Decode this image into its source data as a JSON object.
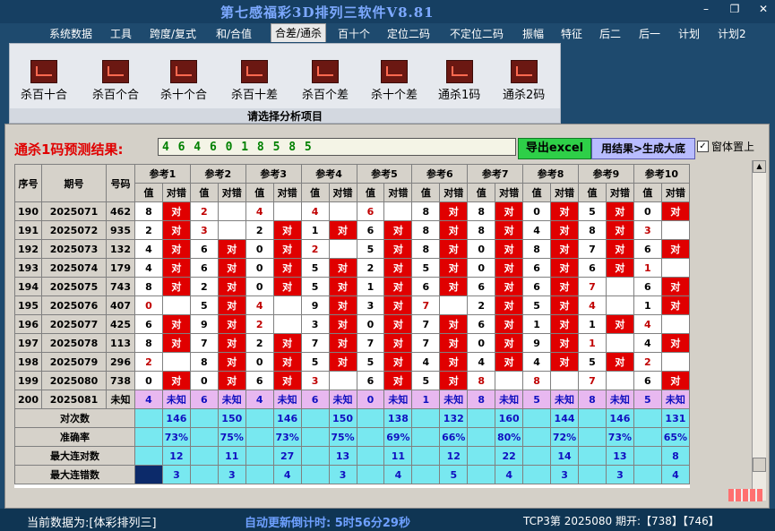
{
  "app": {
    "title": "第七感福彩3D排列三软件V8.81",
    "window_buttons": [
      "–",
      "❐",
      "✕"
    ]
  },
  "menu": [
    "系统数据",
    "工具",
    "跨度/复式",
    "和/合值",
    "合差/通杀",
    "百十个",
    "定位二码",
    "不定位二码",
    "振幅",
    "特征",
    "后二",
    "后一",
    "计划",
    "计划2"
  ],
  "menu_active": "合差/通杀",
  "ribbon": {
    "buttons": [
      "杀百十合",
      "杀百个合",
      "杀十个合",
      "杀百十差",
      "杀百个差",
      "杀十个差",
      "通杀1码",
      "通杀2码"
    ],
    "caption": "请选择分析项目"
  },
  "prediction": {
    "label": "通杀1码预测结果:",
    "value": "4 6 4 6 0 1 8 5 8 5",
    "export_button": "导出excel",
    "generate_button": "用结果>生成大底",
    "checkbox_label": "窗体置上",
    "checkbox_checked": true
  },
  "table": {
    "headers": {
      "seq": "序号",
      "period": "期号",
      "number": "号码",
      "value": "值",
      "result": "对错"
    },
    "refs": [
      "参考1",
      "参考2",
      "参考3",
      "参考4",
      "参考5",
      "参考6",
      "参考7",
      "参考8",
      "参考9",
      "参考10"
    ],
    "correct_mark": "对",
    "rows": [
      {
        "seq": "190",
        "period": "2025071",
        "number": "462",
        "vals": [
          "8",
          "2",
          "4",
          "4",
          "6",
          "8",
          "8",
          "0",
          "5",
          "0"
        ],
        "res": [
          1,
          0,
          0,
          0,
          0,
          1,
          1,
          1,
          1,
          1
        ],
        "hot": [
          0,
          1,
          1,
          1,
          1,
          0,
          0,
          0,
          0,
          0
        ]
      },
      {
        "seq": "191",
        "period": "2025072",
        "number": "935",
        "vals": [
          "2",
          "3",
          "2",
          "1",
          "6",
          "8",
          "8",
          "4",
          "8",
          "3"
        ],
        "res": [
          1,
          0,
          1,
          1,
          1,
          1,
          1,
          1,
          1,
          0
        ],
        "hot": [
          0,
          1,
          0,
          0,
          0,
          0,
          0,
          0,
          0,
          1
        ]
      },
      {
        "seq": "192",
        "period": "2025073",
        "number": "132",
        "vals": [
          "4",
          "6",
          "0",
          "2",
          "5",
          "8",
          "0",
          "8",
          "7",
          "6"
        ],
        "res": [
          1,
          1,
          1,
          0,
          1,
          1,
          1,
          1,
          1,
          1
        ],
        "hot": [
          0,
          0,
          0,
          1,
          0,
          0,
          0,
          0,
          0,
          0
        ]
      },
      {
        "seq": "193",
        "period": "2025074",
        "number": "179",
        "vals": [
          "4",
          "6",
          "0",
          "5",
          "2",
          "5",
          "0",
          "6",
          "6",
          "1"
        ],
        "res": [
          1,
          1,
          1,
          1,
          1,
          1,
          1,
          1,
          1,
          0
        ],
        "hot": [
          0,
          0,
          0,
          0,
          0,
          0,
          0,
          0,
          0,
          1
        ]
      },
      {
        "seq": "194",
        "period": "2025075",
        "number": "743",
        "vals": [
          "8",
          "2",
          "0",
          "5",
          "1",
          "6",
          "6",
          "6",
          "7",
          "6"
        ],
        "res": [
          1,
          1,
          1,
          1,
          1,
          1,
          1,
          1,
          0,
          1
        ],
        "hot": [
          0,
          0,
          0,
          0,
          0,
          0,
          0,
          0,
          1,
          0
        ]
      },
      {
        "seq": "195",
        "period": "2025076",
        "number": "407",
        "vals": [
          "0",
          "5",
          "4",
          "9",
          "3",
          "7",
          "2",
          "5",
          "4",
          "1"
        ],
        "res": [
          0,
          1,
          0,
          1,
          1,
          0,
          1,
          1,
          0,
          1
        ],
        "hot": [
          1,
          0,
          1,
          0,
          0,
          1,
          0,
          0,
          1,
          0
        ]
      },
      {
        "seq": "196",
        "period": "2025077",
        "number": "425",
        "vals": [
          "6",
          "9",
          "2",
          "3",
          "0",
          "7",
          "6",
          "1",
          "1",
          "4"
        ],
        "res": [
          1,
          1,
          0,
          1,
          1,
          1,
          1,
          1,
          1,
          0
        ],
        "hot": [
          0,
          0,
          1,
          0,
          0,
          0,
          0,
          0,
          0,
          1
        ]
      },
      {
        "seq": "197",
        "period": "2025078",
        "number": "113",
        "vals": [
          "8",
          "7",
          "2",
          "7",
          "7",
          "7",
          "0",
          "9",
          "1",
          "4"
        ],
        "res": [
          1,
          1,
          1,
          1,
          1,
          1,
          1,
          1,
          0,
          1
        ],
        "hot": [
          0,
          0,
          0,
          0,
          0,
          0,
          0,
          0,
          1,
          0
        ]
      },
      {
        "seq": "198",
        "period": "2025079",
        "number": "296",
        "vals": [
          "2",
          "8",
          "0",
          "5",
          "5",
          "4",
          "4",
          "4",
          "5",
          "2"
        ],
        "res": [
          0,
          1,
          1,
          1,
          1,
          1,
          1,
          1,
          1,
          0
        ],
        "hot": [
          1,
          0,
          0,
          0,
          0,
          0,
          0,
          0,
          0,
          1
        ]
      },
      {
        "seq": "199",
        "period": "2025080",
        "number": "738",
        "vals": [
          "0",
          "0",
          "6",
          "3",
          "6",
          "5",
          "8",
          "8",
          "7",
          "6"
        ],
        "res": [
          1,
          1,
          1,
          0,
          1,
          1,
          0,
          0,
          0,
          1
        ],
        "hot": [
          0,
          0,
          0,
          1,
          0,
          0,
          1,
          1,
          1,
          0
        ]
      }
    ],
    "unknown_row": {
      "seq": "200",
      "period": "2025081",
      "number": "未知",
      "vals": [
        "4",
        "6",
        "4",
        "6",
        "0",
        "1",
        "8",
        "5",
        "8",
        "5"
      ],
      "status": "未知"
    },
    "stats": [
      {
        "label": "对次数",
        "values": [
          "146",
          "150",
          "146",
          "150",
          "138",
          "132",
          "160",
          "144",
          "146",
          "131"
        ]
      },
      {
        "label": "准确率",
        "values": [
          "73%",
          "75%",
          "73%",
          "75%",
          "69%",
          "66%",
          "80%",
          "72%",
          "73%",
          "65%"
        ]
      },
      {
        "label": "最大连对数",
        "values": [
          "12",
          "11",
          "27",
          "13",
          "11",
          "12",
          "22",
          "14",
          "13",
          "8"
        ]
      },
      {
        "label": "最大连错数",
        "values": [
          "3",
          "3",
          "4",
          "3",
          "4",
          "5",
          "4",
          "3",
          "3",
          "4"
        ]
      }
    ]
  },
  "status": {
    "current_data": "当前数据为:[体彩排列三]",
    "countdown": "自动更新倒计时: 5时56分29秒",
    "draw": "TCP3第 2025080 期开:【738】【746】"
  },
  "colors": {
    "correct": "#e00000",
    "stats_bg": "#78e8f0",
    "unknown_bg": "#e8b8f0",
    "excel_button": "#2ecf48",
    "generate_button": "#b8bcff"
  }
}
